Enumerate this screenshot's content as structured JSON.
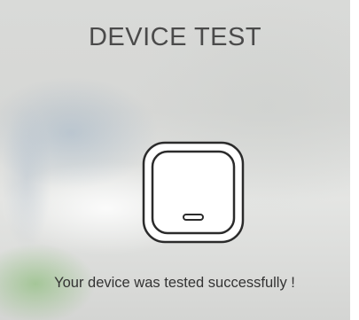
{
  "screen": {
    "title": "DEVICE TEST",
    "message": "Your device was tested successfully !"
  },
  "device": {
    "icon": "smart-switch-device-icon",
    "outline_color": "#2b2b2b",
    "fill_color": "#ffffff"
  }
}
